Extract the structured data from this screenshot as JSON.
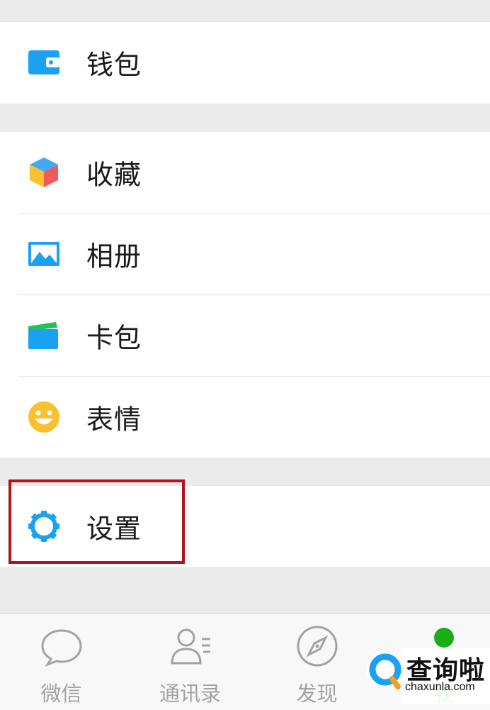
{
  "menu": {
    "wallet": "钱包",
    "favorites": "收藏",
    "album": "相册",
    "card_wallet": "卡包",
    "stickers": "表情",
    "settings": "设置"
  },
  "tabbar": {
    "tabs": [
      {
        "label": "微信",
        "icon": "chat-bubble-icon"
      },
      {
        "label": "通讯录",
        "icon": "contacts-icon"
      },
      {
        "label": "发现",
        "icon": "compass-icon"
      },
      {
        "label": "我",
        "icon": "me-icon",
        "active": true
      }
    ],
    "active_color": "#1aad19"
  },
  "watermark": {
    "text": "查询啦",
    "url": "chaxunla.com"
  },
  "colors": {
    "accent_blue": "#1aa1f2",
    "highlight_red": "#b5121b"
  }
}
